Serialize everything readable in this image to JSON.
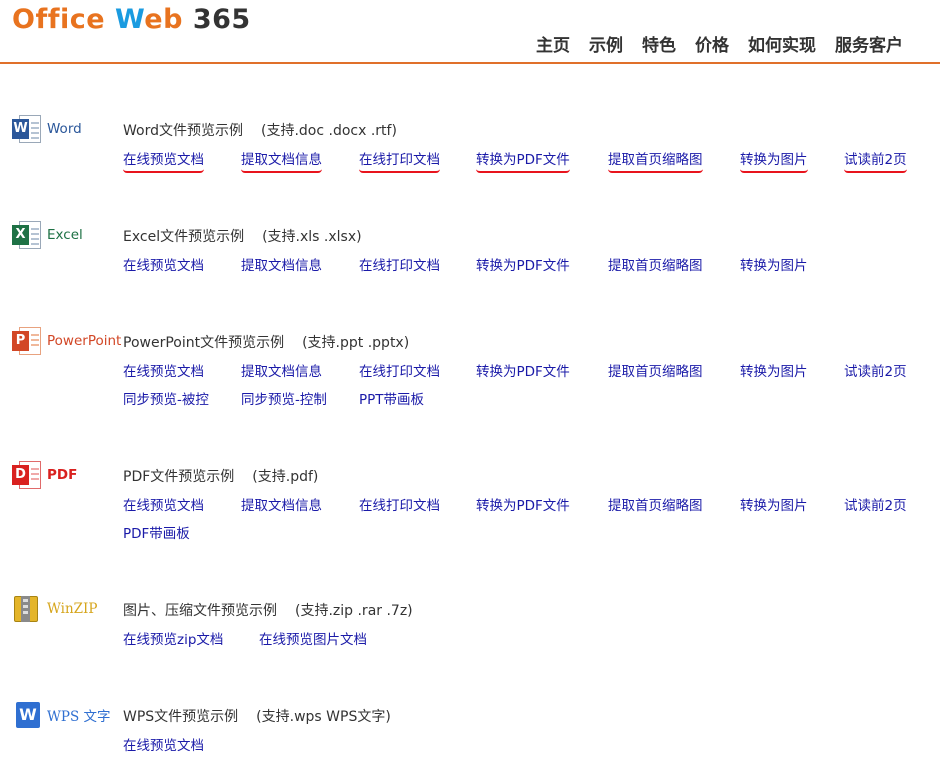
{
  "header": {
    "logo": {
      "part1": "Office",
      "part2": "W",
      "part3": "eb",
      "part4": "365"
    },
    "nav": [
      "主页",
      "示例",
      "特色",
      "价格",
      "如何实现",
      "服务客户"
    ]
  },
  "colors": {
    "accent": "#e0702a",
    "link": "#1a1aa8",
    "highlight": "#e8141d"
  },
  "sections": [
    {
      "icon": "word-icon",
      "name": "Word",
      "title": "Word文件预览示例",
      "support": "(支持.doc .docx .rtf)",
      "rows": [
        [
          "在线预览文档",
          "提取文档信息",
          "在线打印文档",
          "转换为PDF文件",
          "提取首页缩略图",
          "转换为图片",
          "试读前2页"
        ]
      ],
      "highlighted": true
    },
    {
      "icon": "excel-icon",
      "name": "Excel",
      "title": "Excel文件预览示例",
      "support": "(支持.xls .xlsx)",
      "rows": [
        [
          "在线预览文档",
          "提取文档信息",
          "在线打印文档",
          "转换为PDF文件",
          "提取首页缩略图",
          "转换为图片"
        ]
      ]
    },
    {
      "icon": "powerpoint-icon",
      "name": "PowerPoint",
      "title": "PowerPoint文件预览示例",
      "support": "(支持.ppt .pptx)",
      "rows": [
        [
          "在线预览文档",
          "提取文档信息",
          "在线打印文档",
          "转换为PDF文件",
          "提取首页缩略图",
          "转换为图片",
          "试读前2页"
        ],
        [
          "同步预览-被控",
          "同步预览-控制",
          "PPT带画板"
        ]
      ]
    },
    {
      "icon": "pdf-icon",
      "name": "PDF",
      "title": "PDF文件预览示例",
      "support": "(支持.pdf)",
      "rows": [
        [
          "在线预览文档",
          "提取文档信息",
          "在线打印文档",
          "转换为PDF文件",
          "提取首页缩略图",
          "转换为图片",
          "试读前2页"
        ],
        [
          "PDF带画板"
        ]
      ]
    },
    {
      "icon": "winzip-icon",
      "name": "WinZIP",
      "title": "图片、压缩文件预览示例",
      "support": "(支持.zip .rar .7z)",
      "rows": [
        [
          "在线预览zip文档",
          "在线预览图片文档"
        ]
      ]
    },
    {
      "icon": "wps-icon",
      "name": "WPS 文字",
      "title": "WPS文件预览示例",
      "support": "(支持.wps WPS文字)",
      "rows": [
        [
          "在线预览文档"
        ]
      ]
    }
  ]
}
